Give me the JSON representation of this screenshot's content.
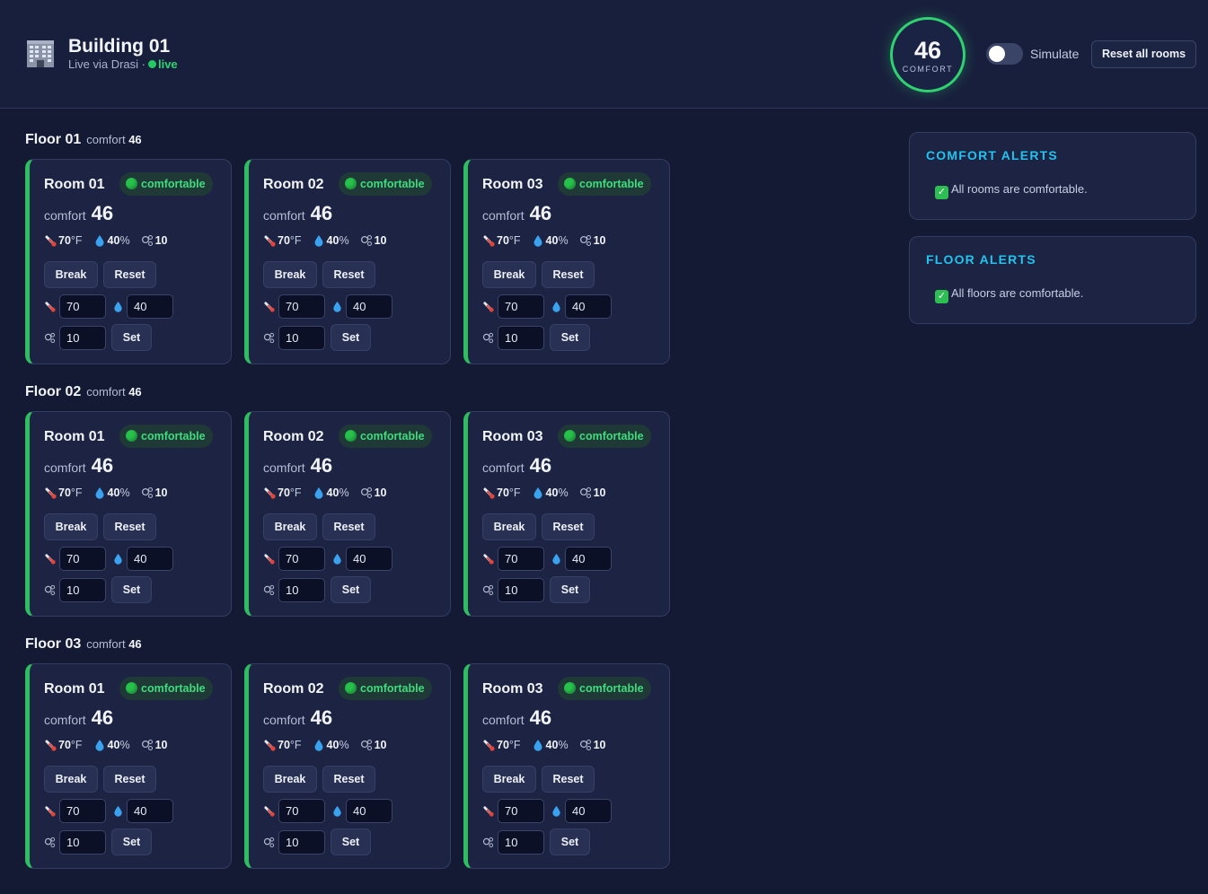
{
  "header": {
    "title": "Building 01",
    "subtitle": "Live via Drasi ·",
    "live": "live",
    "comfort_value": "46",
    "comfort_label": "COMFORT",
    "simulate_label": "Simulate",
    "simulate_on": false,
    "reset_all_label": "Reset all rooms"
  },
  "labels": {
    "comfort": "comfort",
    "break": "Break",
    "reset": "Reset",
    "set": "Set",
    "temp_unit": "°F",
    "humidity_unit": "%"
  },
  "colors": {
    "accent_green": "#2fbd61",
    "alert_title": "#22c3ee",
    "background": "#141a33"
  },
  "icons": {
    "building": "building-icon",
    "temperature": "thermometer-icon",
    "humidity": "droplet-icon",
    "co2": "co2-icon",
    "status": "green-circle-icon",
    "check": "check-icon"
  },
  "floors": [
    {
      "title": "Floor 01",
      "comfort": "46",
      "rooms": [
        {
          "title": "Room 01",
          "status": "comfortable",
          "comfort": "46",
          "temp": "70",
          "humidity": "40",
          "co2": "10",
          "temp_input": "70",
          "humidity_input": "40",
          "co2_input": "10"
        },
        {
          "title": "Room 02",
          "status": "comfortable",
          "comfort": "46",
          "temp": "70",
          "humidity": "40",
          "co2": "10",
          "temp_input": "70",
          "humidity_input": "40",
          "co2_input": "10"
        },
        {
          "title": "Room 03",
          "status": "comfortable",
          "comfort": "46",
          "temp": "70",
          "humidity": "40",
          "co2": "10",
          "temp_input": "70",
          "humidity_input": "40",
          "co2_input": "10"
        }
      ]
    },
    {
      "title": "Floor 02",
      "comfort": "46",
      "rooms": [
        {
          "title": "Room 01",
          "status": "comfortable",
          "comfort": "46",
          "temp": "70",
          "humidity": "40",
          "co2": "10",
          "temp_input": "70",
          "humidity_input": "40",
          "co2_input": "10"
        },
        {
          "title": "Room 02",
          "status": "comfortable",
          "comfort": "46",
          "temp": "70",
          "humidity": "40",
          "co2": "10",
          "temp_input": "70",
          "humidity_input": "40",
          "co2_input": "10"
        },
        {
          "title": "Room 03",
          "status": "comfortable",
          "comfort": "46",
          "temp": "70",
          "humidity": "40",
          "co2": "10",
          "temp_input": "70",
          "humidity_input": "40",
          "co2_input": "10"
        }
      ]
    },
    {
      "title": "Floor 03",
      "comfort": "46",
      "rooms": [
        {
          "title": "Room 01",
          "status": "comfortable",
          "comfort": "46",
          "temp": "70",
          "humidity": "40",
          "co2": "10",
          "temp_input": "70",
          "humidity_input": "40",
          "co2_input": "10"
        },
        {
          "title": "Room 02",
          "status": "comfortable",
          "comfort": "46",
          "temp": "70",
          "humidity": "40",
          "co2": "10",
          "temp_input": "70",
          "humidity_input": "40",
          "co2_input": "10"
        },
        {
          "title": "Room 03",
          "status": "comfortable",
          "comfort": "46",
          "temp": "70",
          "humidity": "40",
          "co2": "10",
          "temp_input": "70",
          "humidity_input": "40",
          "co2_input": "10"
        }
      ]
    }
  ],
  "alerts": [
    {
      "title": "COMFORT ALERTS",
      "message": "All rooms are comfortable."
    },
    {
      "title": "FLOOR ALERTS",
      "message": "All floors are comfortable."
    }
  ]
}
